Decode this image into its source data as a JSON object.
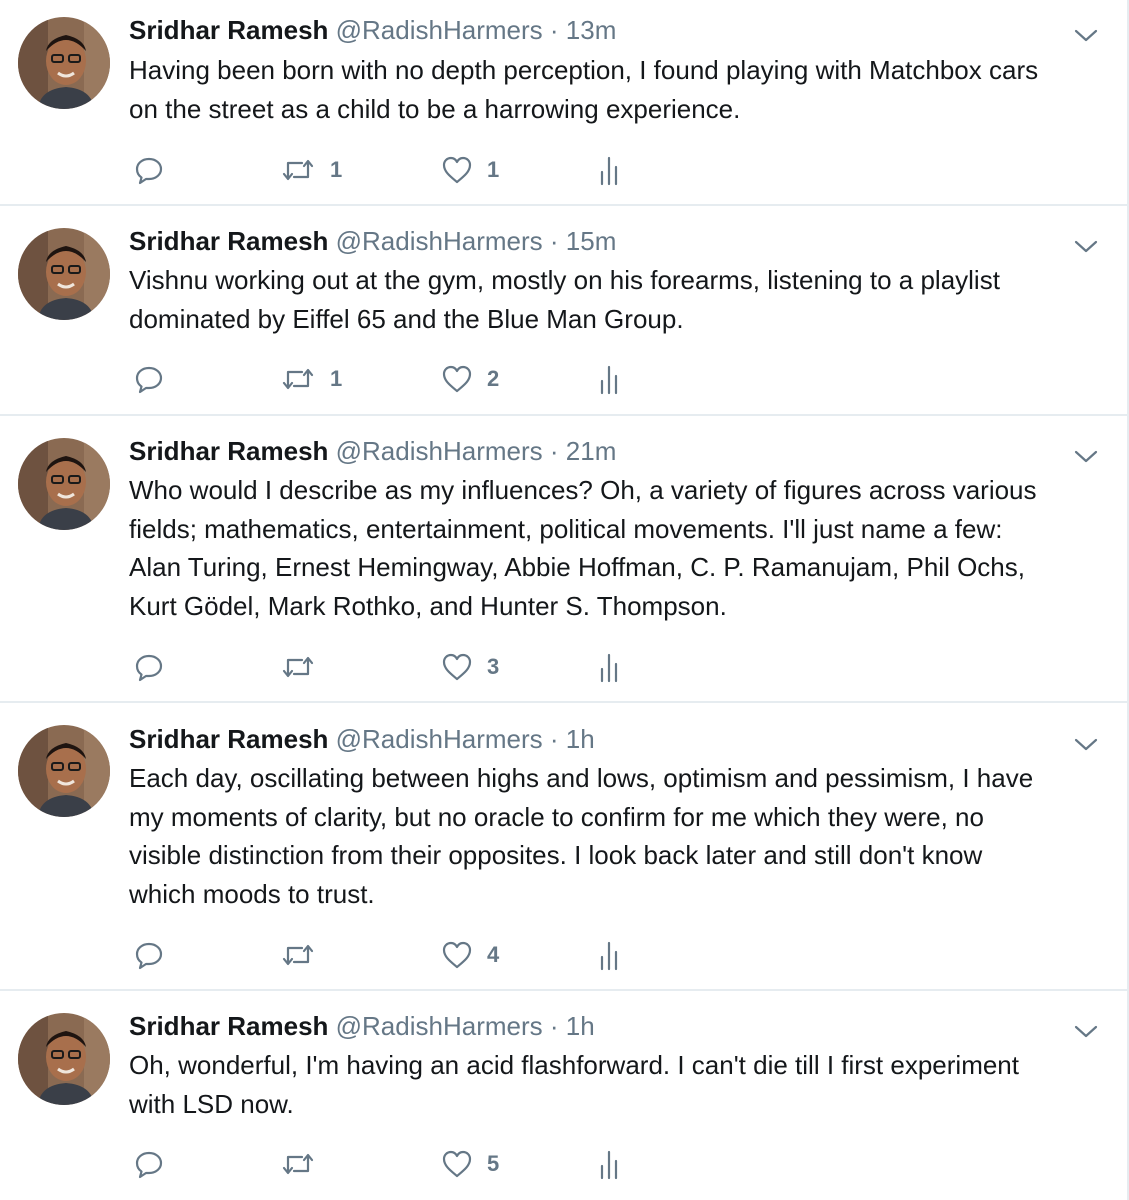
{
  "icons": {
    "reply": "reply-icon",
    "retweet": "retweet-icon",
    "like": "heart-icon",
    "stats": "analytics-icon",
    "more": "chevron-down-icon"
  },
  "colors": {
    "secondary_text": "#657786",
    "divider": "#e6ecf0",
    "icon": "#657786"
  },
  "tweets": [
    {
      "name": "Sridhar Ramesh",
      "handle": "@RadishHarmers",
      "separator": "·",
      "time": "13m",
      "text": "Having been born with no depth perception, I found playing with Matchbox cars\non the street as a child to be a harrowing experience.",
      "replies": "",
      "retweets": "1",
      "likes": "1"
    },
    {
      "name": "Sridhar Ramesh",
      "handle": "@RadishHarmers",
      "separator": "·",
      "time": "15m",
      "text": "Vishnu working out at the gym, mostly on his forearms, listening to a playlist\ndominated by Eiffel 65 and the Blue Man Group.",
      "replies": "",
      "retweets": "1",
      "likes": "2"
    },
    {
      "name": "Sridhar Ramesh",
      "handle": "@RadishHarmers",
      "separator": "·",
      "time": "21m",
      "text": "Who would I describe as my influences? Oh, a variety of figures across various\nfields; mathematics, entertainment, political movements. I'll just name a few:\nAlan Turing, Ernest Hemingway, Abbie Hoffman, C. P. Ramanujam, Phil Ochs,\nKurt Gödel, Mark Rothko, and Hunter S. Thompson.",
      "replies": "",
      "retweets": "",
      "likes": "3"
    },
    {
      "name": "Sridhar Ramesh",
      "handle": "@RadishHarmers",
      "separator": "·",
      "time": "1h",
      "text": "Each day, oscillating between highs and lows, optimism and pessimism, I have\nmy moments of clarity, but no oracle to confirm for me which they were, no\nvisible distinction from their opposites. I look back later and still don't know\nwhich moods to trust.",
      "replies": "",
      "retweets": "",
      "likes": "4"
    },
    {
      "name": "Sridhar Ramesh",
      "handle": "@RadishHarmers",
      "separator": "·",
      "time": "1h",
      "text": "Oh, wonderful, I'm having an acid flashforward. I can't die till I first experiment\nwith LSD now.",
      "replies": "",
      "retweets": "",
      "likes": "5"
    }
  ]
}
